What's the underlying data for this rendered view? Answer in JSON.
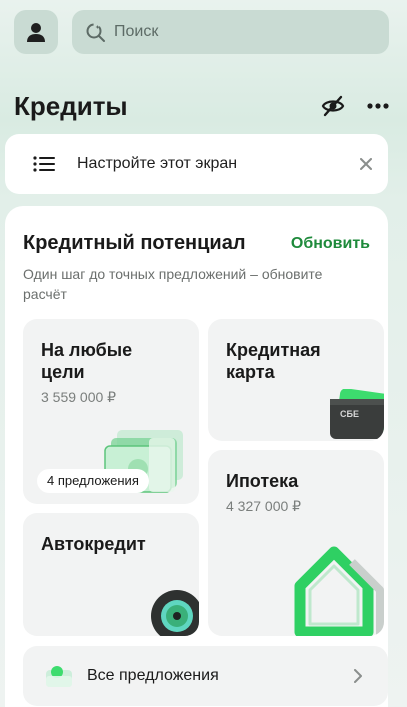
{
  "search": {
    "placeholder": "Поиск"
  },
  "header": {
    "title": "Кредиты"
  },
  "banner": {
    "text": "Настройте этот экран"
  },
  "potential": {
    "title": "Кредитный потенциал",
    "refresh_label": "Обновить",
    "subtitle": "Один шаг до точных предложений – обновите расчёт"
  },
  "tiles": {
    "any_purpose": {
      "title": "На любые цели",
      "amount": "3 559 000 ₽",
      "badge": "4 предложения"
    },
    "credit_card": {
      "title": "Кредитная карта",
      "card_text": "СБЕ"
    },
    "mortgage": {
      "title": "Ипотека",
      "amount": "4 327 000 ₽"
    },
    "auto": {
      "title": "Автокредит"
    }
  },
  "all_offers": {
    "label": "Все предложения"
  },
  "colors": {
    "accent": "#1e8a3b",
    "background": "#e2efe9",
    "tile": "#f2f3f3"
  }
}
